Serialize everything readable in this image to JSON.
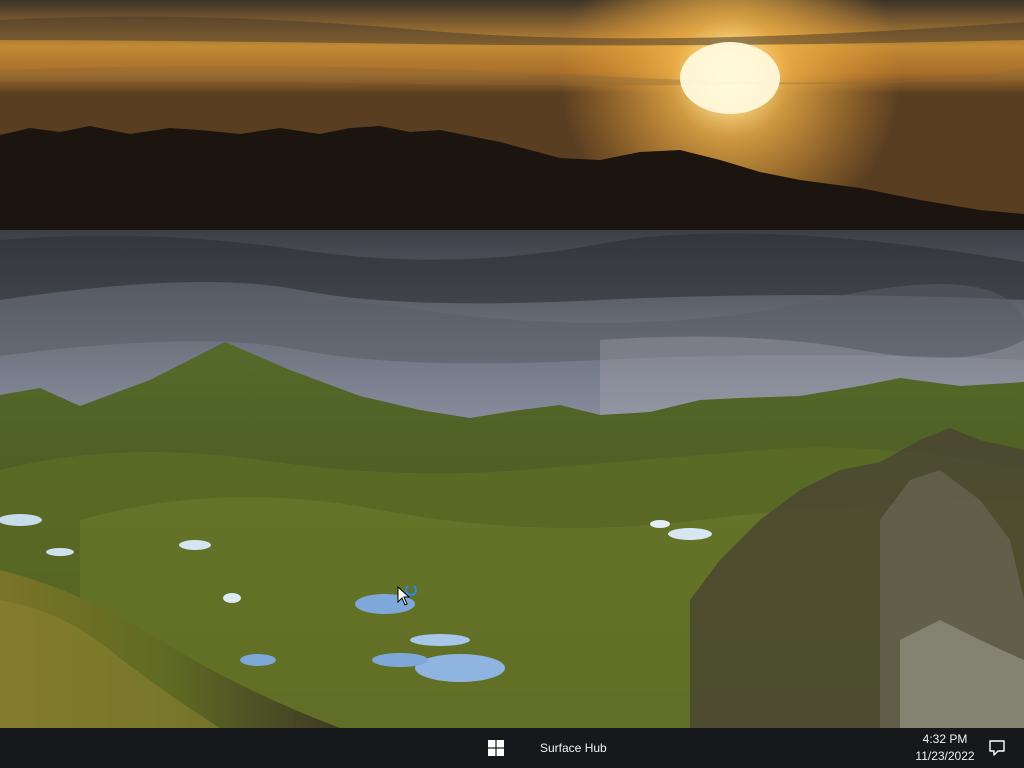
{
  "desktop": {
    "wallpaper": "mountain-sunset-landscape",
    "cursor": "pointer-busy-icon"
  },
  "taskbar": {
    "background": "#16181c",
    "start_icon": "windows-logo-icon",
    "app_label": "Surface Hub",
    "clock": {
      "time": "4:32 PM",
      "date": "11/23/2022"
    },
    "notification_icon": "action-center-icon"
  }
}
